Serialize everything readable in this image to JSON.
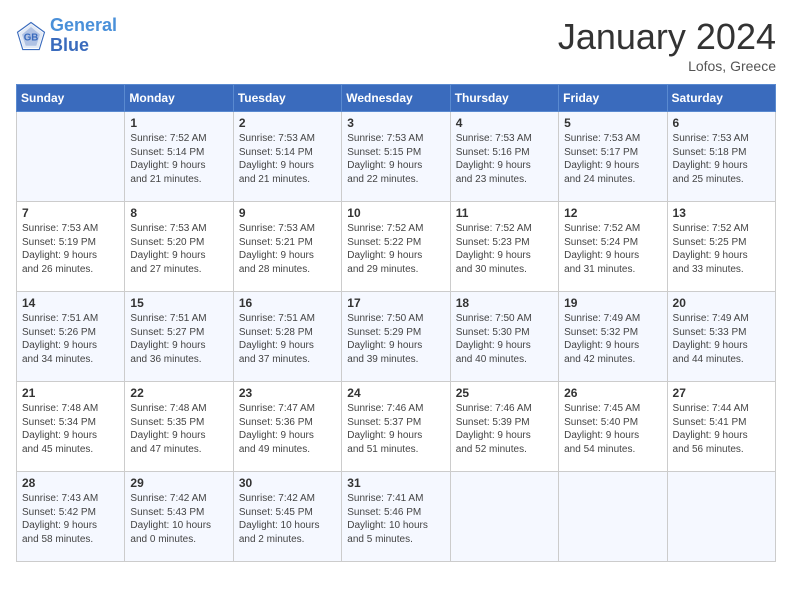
{
  "header": {
    "logo_line1": "General",
    "logo_line2": "Blue",
    "month": "January 2024",
    "location": "Lofos, Greece"
  },
  "days_of_week": [
    "Sunday",
    "Monday",
    "Tuesday",
    "Wednesday",
    "Thursday",
    "Friday",
    "Saturday"
  ],
  "weeks": [
    [
      {
        "day": "",
        "info": ""
      },
      {
        "day": "1",
        "info": "Sunrise: 7:52 AM\nSunset: 5:14 PM\nDaylight: 9 hours\nand 21 minutes."
      },
      {
        "day": "2",
        "info": "Sunrise: 7:53 AM\nSunset: 5:14 PM\nDaylight: 9 hours\nand 21 minutes."
      },
      {
        "day": "3",
        "info": "Sunrise: 7:53 AM\nSunset: 5:15 PM\nDaylight: 9 hours\nand 22 minutes."
      },
      {
        "day": "4",
        "info": "Sunrise: 7:53 AM\nSunset: 5:16 PM\nDaylight: 9 hours\nand 23 minutes."
      },
      {
        "day": "5",
        "info": "Sunrise: 7:53 AM\nSunset: 5:17 PM\nDaylight: 9 hours\nand 24 minutes."
      },
      {
        "day": "6",
        "info": "Sunrise: 7:53 AM\nSunset: 5:18 PM\nDaylight: 9 hours\nand 25 minutes."
      }
    ],
    [
      {
        "day": "7",
        "info": "Sunrise: 7:53 AM\nSunset: 5:19 PM\nDaylight: 9 hours\nand 26 minutes."
      },
      {
        "day": "8",
        "info": "Sunrise: 7:53 AM\nSunset: 5:20 PM\nDaylight: 9 hours\nand 27 minutes."
      },
      {
        "day": "9",
        "info": "Sunrise: 7:53 AM\nSunset: 5:21 PM\nDaylight: 9 hours\nand 28 minutes."
      },
      {
        "day": "10",
        "info": "Sunrise: 7:52 AM\nSunset: 5:22 PM\nDaylight: 9 hours\nand 29 minutes."
      },
      {
        "day": "11",
        "info": "Sunrise: 7:52 AM\nSunset: 5:23 PM\nDaylight: 9 hours\nand 30 minutes."
      },
      {
        "day": "12",
        "info": "Sunrise: 7:52 AM\nSunset: 5:24 PM\nDaylight: 9 hours\nand 31 minutes."
      },
      {
        "day": "13",
        "info": "Sunrise: 7:52 AM\nSunset: 5:25 PM\nDaylight: 9 hours\nand 33 minutes."
      }
    ],
    [
      {
        "day": "14",
        "info": "Sunrise: 7:51 AM\nSunset: 5:26 PM\nDaylight: 9 hours\nand 34 minutes."
      },
      {
        "day": "15",
        "info": "Sunrise: 7:51 AM\nSunset: 5:27 PM\nDaylight: 9 hours\nand 36 minutes."
      },
      {
        "day": "16",
        "info": "Sunrise: 7:51 AM\nSunset: 5:28 PM\nDaylight: 9 hours\nand 37 minutes."
      },
      {
        "day": "17",
        "info": "Sunrise: 7:50 AM\nSunset: 5:29 PM\nDaylight: 9 hours\nand 39 minutes."
      },
      {
        "day": "18",
        "info": "Sunrise: 7:50 AM\nSunset: 5:30 PM\nDaylight: 9 hours\nand 40 minutes."
      },
      {
        "day": "19",
        "info": "Sunrise: 7:49 AM\nSunset: 5:32 PM\nDaylight: 9 hours\nand 42 minutes."
      },
      {
        "day": "20",
        "info": "Sunrise: 7:49 AM\nSunset: 5:33 PM\nDaylight: 9 hours\nand 44 minutes."
      }
    ],
    [
      {
        "day": "21",
        "info": "Sunrise: 7:48 AM\nSunset: 5:34 PM\nDaylight: 9 hours\nand 45 minutes."
      },
      {
        "day": "22",
        "info": "Sunrise: 7:48 AM\nSunset: 5:35 PM\nDaylight: 9 hours\nand 47 minutes."
      },
      {
        "day": "23",
        "info": "Sunrise: 7:47 AM\nSunset: 5:36 PM\nDaylight: 9 hours\nand 49 minutes."
      },
      {
        "day": "24",
        "info": "Sunrise: 7:46 AM\nSunset: 5:37 PM\nDaylight: 9 hours\nand 51 minutes."
      },
      {
        "day": "25",
        "info": "Sunrise: 7:46 AM\nSunset: 5:39 PM\nDaylight: 9 hours\nand 52 minutes."
      },
      {
        "day": "26",
        "info": "Sunrise: 7:45 AM\nSunset: 5:40 PM\nDaylight: 9 hours\nand 54 minutes."
      },
      {
        "day": "27",
        "info": "Sunrise: 7:44 AM\nSunset: 5:41 PM\nDaylight: 9 hours\nand 56 minutes."
      }
    ],
    [
      {
        "day": "28",
        "info": "Sunrise: 7:43 AM\nSunset: 5:42 PM\nDaylight: 9 hours\nand 58 minutes."
      },
      {
        "day": "29",
        "info": "Sunrise: 7:42 AM\nSunset: 5:43 PM\nDaylight: 10 hours\nand 0 minutes."
      },
      {
        "day": "30",
        "info": "Sunrise: 7:42 AM\nSunset: 5:45 PM\nDaylight: 10 hours\nand 2 minutes."
      },
      {
        "day": "31",
        "info": "Sunrise: 7:41 AM\nSunset: 5:46 PM\nDaylight: 10 hours\nand 5 minutes."
      },
      {
        "day": "",
        "info": ""
      },
      {
        "day": "",
        "info": ""
      },
      {
        "day": "",
        "info": ""
      }
    ]
  ]
}
